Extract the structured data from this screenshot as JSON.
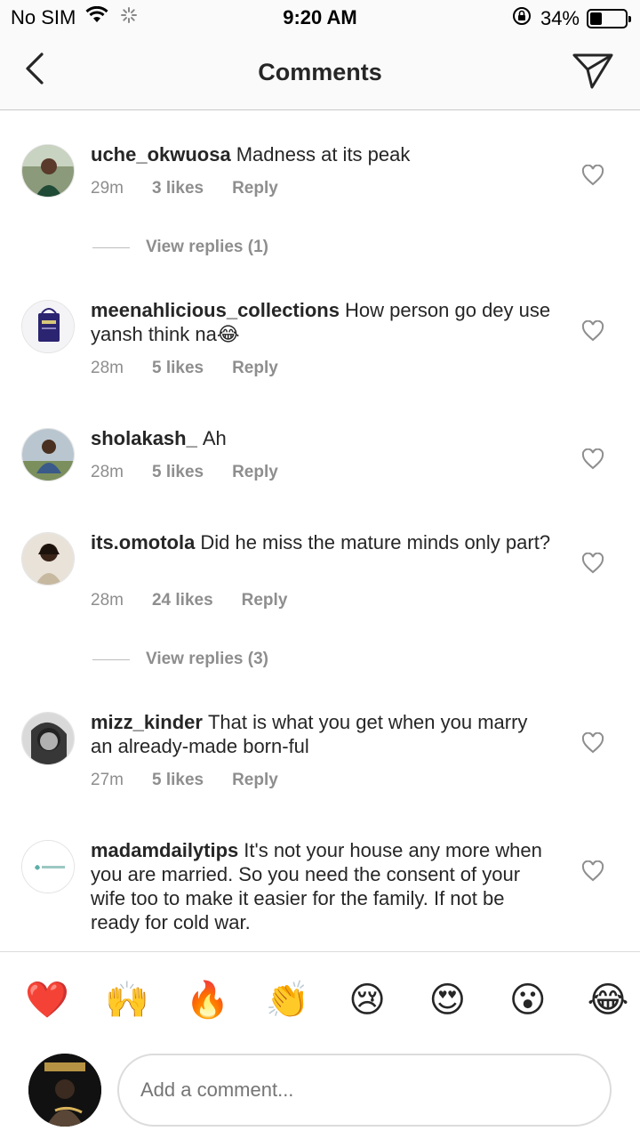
{
  "status_bar": {
    "carrier": "No SIM",
    "time": "9:20 AM",
    "battery_percent": "34%",
    "battery_level": 0.34
  },
  "nav": {
    "title": "Comments",
    "back_icon": "chevron-left-icon",
    "share_icon": "paper-plane-icon"
  },
  "comments": [
    {
      "username": "uche_okwuosa",
      "text": "Madness at its peak",
      "time": "29m",
      "likes": "3 likes",
      "reply": "Reply"
    },
    {
      "username": "meenahlicious_collections",
      "text": "How person go dey use yansh think na😂",
      "time": "28m",
      "likes": "5 likes",
      "reply": "Reply"
    },
    {
      "username": "sholakash_",
      "text": "Ah",
      "time": "28m",
      "likes": "5 likes",
      "reply": "Reply"
    },
    {
      "username": "its.omotola",
      "text": "Did he miss the mature minds only part?",
      "time": "28m",
      "likes": "24 likes",
      "reply": "Reply"
    },
    {
      "username": "mizz_kinder",
      "text": "That is what you get when you marry an already-made born-ful",
      "time": "27m",
      "likes": "5 likes",
      "reply": "Reply"
    },
    {
      "username": "madamdailytips",
      "text": "It's not your house any more when you are married. So you need the consent of your wife too to make it easier for the family. If not be ready for cold war.",
      "time": "",
      "likes": "",
      "reply": ""
    }
  ],
  "view_replies": [
    "View replies (1)",
    "View replies (3)"
  ],
  "emoji_bar": [
    "❤️",
    "🙌",
    "🔥",
    "👏",
    "😢",
    "😍",
    "😮",
    "😂"
  ],
  "input": {
    "placeholder": "Add a comment..."
  },
  "colors": {
    "text": "#262626",
    "muted": "#8e8e8e",
    "divider": "#dbdbdb",
    "header_bg": "#fafafa"
  }
}
